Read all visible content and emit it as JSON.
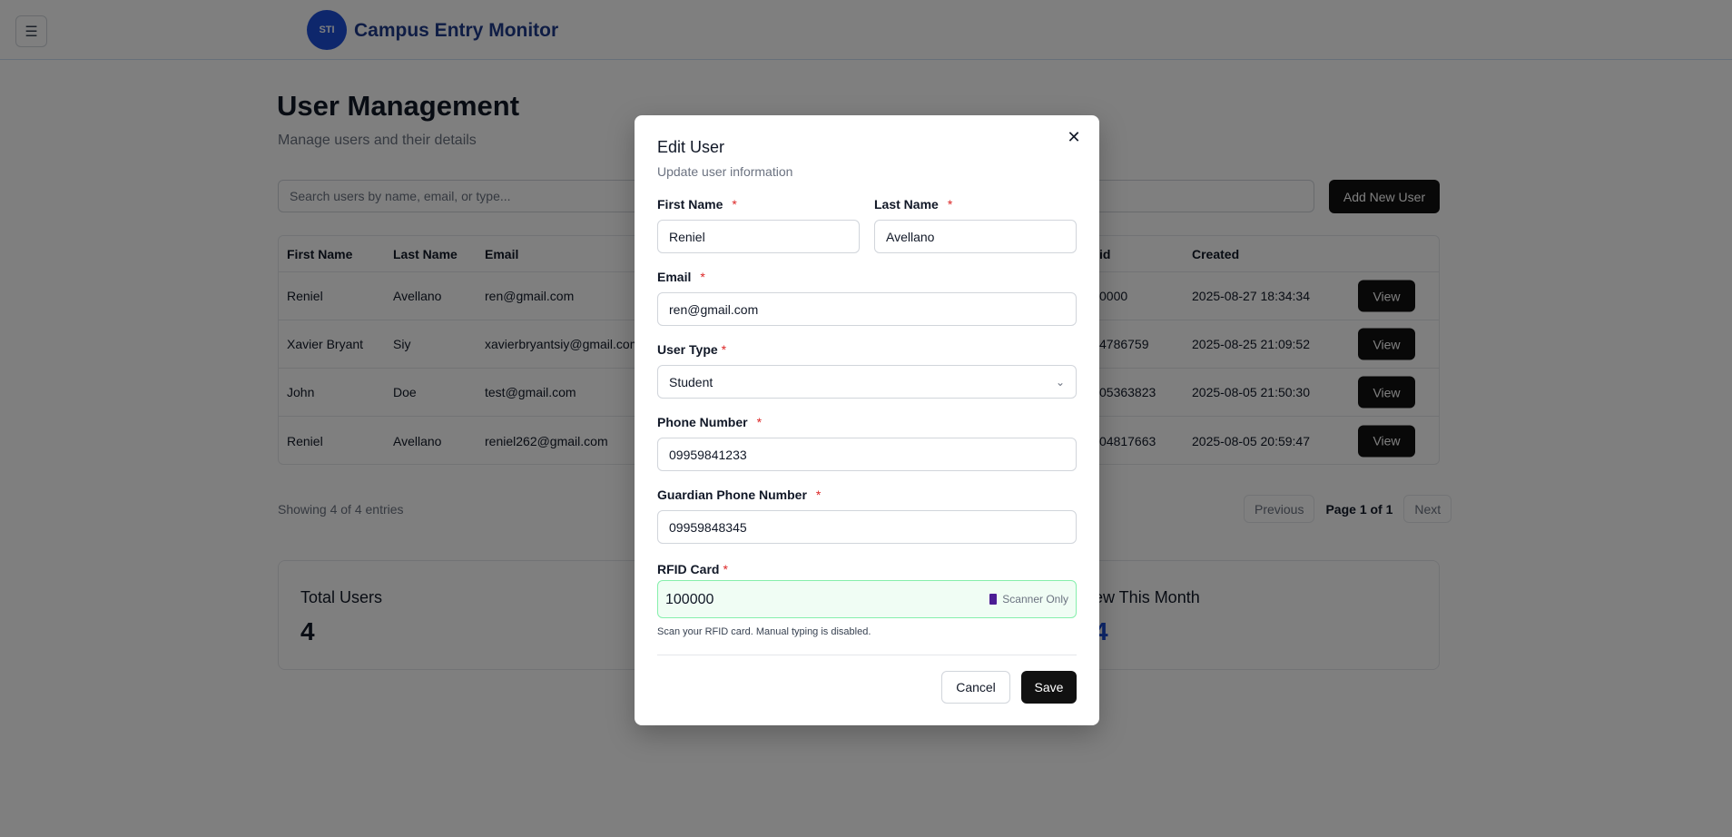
{
  "header": {
    "menu_icon": "☰",
    "logo_text": "STI",
    "app_title": "Campus Entry Monitor"
  },
  "page": {
    "title": "User Management",
    "subtitle": "Manage users and their details",
    "search_placeholder": "Search users by name, email, or type...",
    "add_button": "Add New User"
  },
  "table": {
    "columns": [
      "First Name",
      "Last Name",
      "Email",
      "id",
      "Created"
    ],
    "rows": [
      {
        "first": "Reniel",
        "last": "Avellano",
        "email": "ren@gmail.com",
        "rfid": "0000",
        "created": "2025-08-27 18:34:34",
        "action": "View"
      },
      {
        "first": "Xavier Bryant",
        "last": "Siy",
        "email": "xavierbryantsiy@gmail.com",
        "rfid": "4786759",
        "created": "2025-08-25 21:09:52",
        "action": "View"
      },
      {
        "first": "John",
        "last": "Doe",
        "email": "test@gmail.com",
        "rfid": "05363823",
        "created": "2025-08-05 21:50:30",
        "action": "View"
      },
      {
        "first": "Reniel",
        "last": "Avellano",
        "email": "reniel262@gmail.com",
        "rfid": "04817663",
        "created": "2025-08-05 20:59:47",
        "action": "View"
      }
    ]
  },
  "pagination": {
    "showing": "Showing 4 of 4 entries",
    "previous": "Previous",
    "page_info": "Page 1 of 1",
    "next": "Next"
  },
  "stats": {
    "total_label": "Total Users",
    "total_value": "4",
    "month_label": "ew This Month",
    "month_value": "4"
  },
  "modal": {
    "title": "Edit User",
    "subtitle": "Update user information",
    "close_icon": "✕",
    "first_name_label": "First Name",
    "first_name_value": "Reniel",
    "last_name_label": "Last Name",
    "last_name_value": "Avellano",
    "email_label": "Email",
    "email_value": "ren@gmail.com",
    "user_type_label": "User Type",
    "user_type_value": "Student",
    "phone_label": "Phone Number",
    "phone_value": "09959841233",
    "guardian_label": "Guardian Phone Number",
    "guardian_value": "09959848345",
    "rfid_label": "RFID Card",
    "rfid_value": "100000",
    "rfid_tag": "Scanner Only",
    "rfid_help": "Scan your RFID card. Manual typing is disabled.",
    "required_mark": "*",
    "cancel": "Cancel",
    "save": "Save"
  },
  "colors": {
    "accent_dark": "#111111",
    "brand_blue": "#1e3a8a",
    "stat_blue": "#1d4ed8",
    "rfid_bg": "#f0fdf4",
    "rfid_border": "#86efac",
    "required": "#dc2626"
  }
}
